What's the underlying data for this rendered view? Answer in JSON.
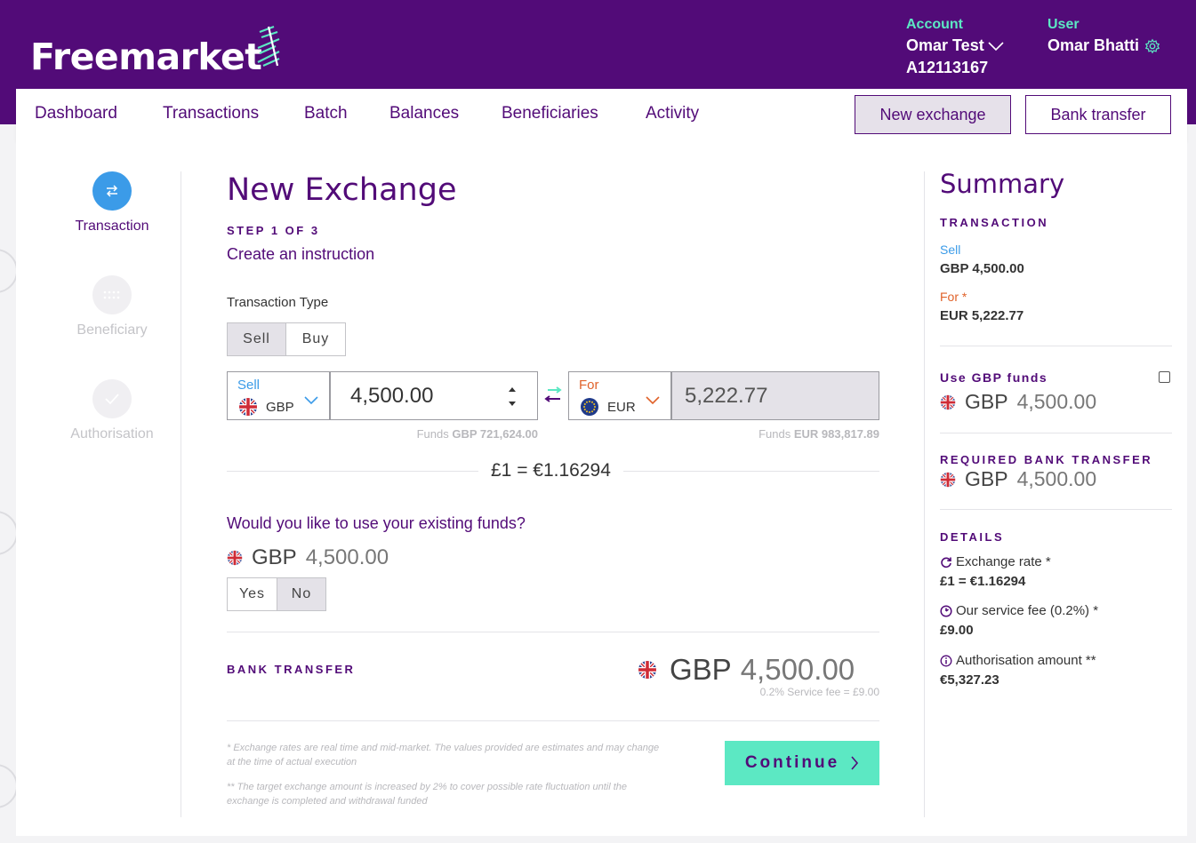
{
  "header": {
    "logo": "Freemarket",
    "account_label": "Account",
    "account_name": "Omar Test",
    "account_id": "A12113167",
    "user_label": "User",
    "user_name": "Omar Bhatti"
  },
  "nav": {
    "items": [
      "Dashboard",
      "Transactions",
      "Batch",
      "Balances",
      "Beneficiaries",
      "Activity"
    ],
    "new_exchange": "New exchange",
    "bank_transfer": "Bank transfer"
  },
  "stepper": {
    "steps": [
      "Transaction",
      "Beneficiary",
      "Authorisation"
    ]
  },
  "form": {
    "title": "New Exchange",
    "step": "STEP 1 OF 3",
    "subtitle": "Create an instruction",
    "transaction_type_label": "Transaction Type",
    "type_options": [
      "Sell",
      "Buy"
    ],
    "sell_label": "Sell",
    "sell_ccy": "GBP",
    "sell_amount": "4,500.00",
    "for_label": "For",
    "for_ccy": "EUR",
    "for_amount": "5,222.77",
    "sell_funds_prefix": "Funds",
    "sell_funds": "GBP 721,624.00",
    "for_funds_prefix": "Funds",
    "for_funds": "EUR 983,817.89",
    "rate": "£1 = €1.16294",
    "existing_funds_question": "Would you like to use your existing funds?",
    "existing_ccy": "GBP",
    "existing_amount": "4,500.00",
    "yes_no": [
      "Yes",
      "No"
    ],
    "bank_transfer_label": "BANK TRANSFER",
    "bank_ccy": "GBP",
    "bank_amount": "4,500.00",
    "fee_note": "0.2% Service fee = £9.00",
    "footnote1": "* Exchange rates are real time and mid-market. The values provided are estimates and may change at the time of actual execution",
    "footnote2": "** The target exchange amount is increased by 2% to cover possible rate fluctuation until the exchange is completed and withdrawal funded",
    "continue": "Continue"
  },
  "summary": {
    "title": "Summary",
    "transaction_label": "TRANSACTION",
    "sell_label": "Sell",
    "sell_value": "GBP 4,500.00",
    "for_label": "For *",
    "for_value": "EUR 5,222.77",
    "use_funds_label": "Use GBP funds",
    "use_funds_ccy": "GBP",
    "use_funds_amount": "4,500.00",
    "required_label": "REQUIRED BANK TRANSFER",
    "required_ccy": "GBP",
    "required_amount": "4,500.00",
    "details_label": "DETAILS",
    "rate_label": "Exchange rate *",
    "rate_value": "£1 = €1.16294",
    "fee_label": "Our service fee (0.2%) *",
    "fee_value": "£9.00",
    "auth_label": "Authorisation amount **",
    "auth_value": "€5,327.23"
  },
  "colors": {
    "brand_purple": "#520b78",
    "accent_green": "#5ce8c3",
    "active_step": "#3b9be8",
    "sell_blue": "#3b9be8",
    "for_orange": "#e0622a"
  }
}
